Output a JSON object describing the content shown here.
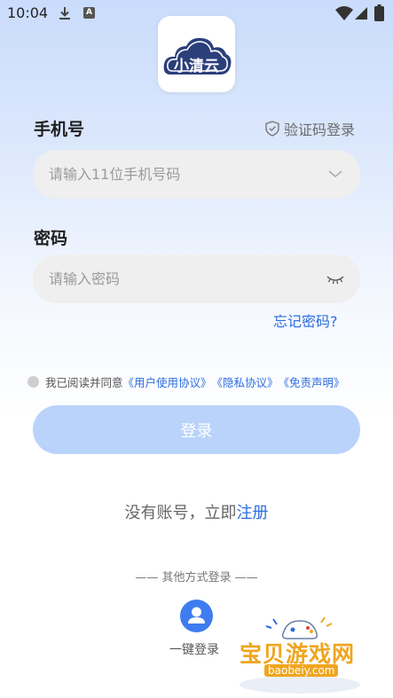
{
  "status_bar": {
    "time": "10:04",
    "icons": [
      "download-icon",
      "a-notification-icon",
      "wifi-icon",
      "signal-icon",
      "battery-icon"
    ]
  },
  "logo": {
    "text": "小清云"
  },
  "phone": {
    "label": "手机号",
    "placeholder": "请输入11位手机号码",
    "sms_login": "验证码登录"
  },
  "password": {
    "label": "密码",
    "placeholder": "请输入密码",
    "forgot": "忘记密码?"
  },
  "agreement": {
    "prefix": "我已阅读并同意",
    "user_agreement": "《用户使用协议》",
    "privacy": "《隐私协议》",
    "disclaimer": "《免责声明》"
  },
  "login_button": "登录",
  "register": {
    "prompt": "没有账号，立即",
    "link": "注册"
  },
  "other_login": {
    "title": "—— 其他方式登录 ——",
    "one_key": "一键登录"
  },
  "watermark": {
    "text": "宝贝游戏网",
    "url": "baobeiy.com"
  },
  "colors": {
    "accent": "#2c6de0",
    "button_disabled": "#b9d3fb",
    "field_bg": "#efefef",
    "brand_navy": "#2b3f7a"
  }
}
